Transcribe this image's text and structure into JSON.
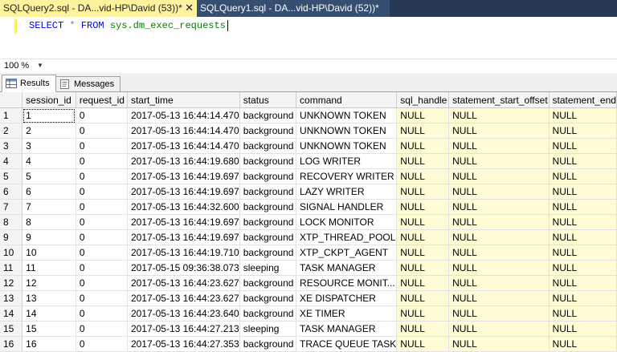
{
  "tabs": [
    {
      "title": "SQLQuery2.sql - DA...vid-HP\\David (53))*",
      "close": "✕"
    },
    {
      "title": "SQLQuery1.sql - DA...vid-HP\\David (52))*"
    }
  ],
  "editor": {
    "keyword_select": "SELECT",
    "operator_star": "*",
    "keyword_from": "FROM",
    "object_name": "sys.dm_exec_requests"
  },
  "zoom": {
    "value": "100 %"
  },
  "result_tabs": {
    "results": "Results",
    "messages": "Messages"
  },
  "grid": {
    "columns": [
      "session_id",
      "request_id",
      "start_time",
      "status",
      "command",
      "sql_handle",
      "statement_start_offset",
      "statement_end"
    ],
    "rows": [
      {
        "n": "1",
        "session_id": "1",
        "request_id": "0",
        "start_time": "2017-05-13 16:44:14.470",
        "status": "background",
        "command": "UNKNOWN TOKEN",
        "sql_handle": "NULL",
        "statement_start_offset": "NULL",
        "statement_end": "NULL"
      },
      {
        "n": "2",
        "session_id": "2",
        "request_id": "0",
        "start_time": "2017-05-13 16:44:14.470",
        "status": "background",
        "command": "UNKNOWN TOKEN",
        "sql_handle": "NULL",
        "statement_start_offset": "NULL",
        "statement_end": "NULL"
      },
      {
        "n": "3",
        "session_id": "3",
        "request_id": "0",
        "start_time": "2017-05-13 16:44:14.470",
        "status": "background",
        "command": "UNKNOWN TOKEN",
        "sql_handle": "NULL",
        "statement_start_offset": "NULL",
        "statement_end": "NULL"
      },
      {
        "n": "4",
        "session_id": "4",
        "request_id": "0",
        "start_time": "2017-05-13 16:44:19.680",
        "status": "background",
        "command": "LOG WRITER",
        "sql_handle": "NULL",
        "statement_start_offset": "NULL",
        "statement_end": "NULL"
      },
      {
        "n": "5",
        "session_id": "5",
        "request_id": "0",
        "start_time": "2017-05-13 16:44:19.697",
        "status": "background",
        "command": "RECOVERY WRITER",
        "sql_handle": "NULL",
        "statement_start_offset": "NULL",
        "statement_end": "NULL"
      },
      {
        "n": "6",
        "session_id": "6",
        "request_id": "0",
        "start_time": "2017-05-13 16:44:19.697",
        "status": "background",
        "command": "LAZY WRITER",
        "sql_handle": "NULL",
        "statement_start_offset": "NULL",
        "statement_end": "NULL"
      },
      {
        "n": "7",
        "session_id": "7",
        "request_id": "0",
        "start_time": "2017-05-13 16:44:32.600",
        "status": "background",
        "command": "SIGNAL HANDLER",
        "sql_handle": "NULL",
        "statement_start_offset": "NULL",
        "statement_end": "NULL"
      },
      {
        "n": "8",
        "session_id": "8",
        "request_id": "0",
        "start_time": "2017-05-13 16:44:19.697",
        "status": "background",
        "command": "LOCK MONITOR",
        "sql_handle": "NULL",
        "statement_start_offset": "NULL",
        "statement_end": "NULL"
      },
      {
        "n": "9",
        "session_id": "9",
        "request_id": "0",
        "start_time": "2017-05-13 16:44:19.697",
        "status": "background",
        "command": "XTP_THREAD_POOL",
        "sql_handle": "NULL",
        "statement_start_offset": "NULL",
        "statement_end": "NULL"
      },
      {
        "n": "10",
        "session_id": "10",
        "request_id": "0",
        "start_time": "2017-05-13 16:44:19.710",
        "status": "background",
        "command": "XTP_CKPT_AGENT",
        "sql_handle": "NULL",
        "statement_start_offset": "NULL",
        "statement_end": "NULL"
      },
      {
        "n": "11",
        "session_id": "11",
        "request_id": "0",
        "start_time": "2017-05-15 09:36:38.073",
        "status": "sleeping",
        "command": "TASK MANAGER",
        "sql_handle": "NULL",
        "statement_start_offset": "NULL",
        "statement_end": "NULL"
      },
      {
        "n": "12",
        "session_id": "12",
        "request_id": "0",
        "start_time": "2017-05-13 16:44:23.627",
        "status": "background",
        "command": "RESOURCE MONIT...",
        "sql_handle": "NULL",
        "statement_start_offset": "NULL",
        "statement_end": "NULL"
      },
      {
        "n": "13",
        "session_id": "13",
        "request_id": "0",
        "start_time": "2017-05-13 16:44:23.627",
        "status": "background",
        "command": "XE DISPATCHER",
        "sql_handle": "NULL",
        "statement_start_offset": "NULL",
        "statement_end": "NULL"
      },
      {
        "n": "14",
        "session_id": "14",
        "request_id": "0",
        "start_time": "2017-05-13 16:44:23.640",
        "status": "background",
        "command": "XE TIMER",
        "sql_handle": "NULL",
        "statement_start_offset": "NULL",
        "statement_end": "NULL"
      },
      {
        "n": "15",
        "session_id": "15",
        "request_id": "0",
        "start_time": "2017-05-13 16:44:27.213",
        "status": "sleeping",
        "command": "TASK MANAGER",
        "sql_handle": "NULL",
        "statement_start_offset": "NULL",
        "statement_end": "NULL"
      },
      {
        "n": "16",
        "session_id": "16",
        "request_id": "0",
        "start_time": "2017-05-13 16:44:27.353",
        "status": "background",
        "command": "TRACE QUEUE TASK",
        "sql_handle": "NULL",
        "statement_start_offset": "NULL",
        "statement_end": "NULL"
      }
    ]
  },
  "colors": {
    "active_tab": "#fff29d",
    "tab_strip": "#293955",
    "null_cell": "#fffbd4",
    "keyword": "#0000ff",
    "object": "#008000"
  }
}
